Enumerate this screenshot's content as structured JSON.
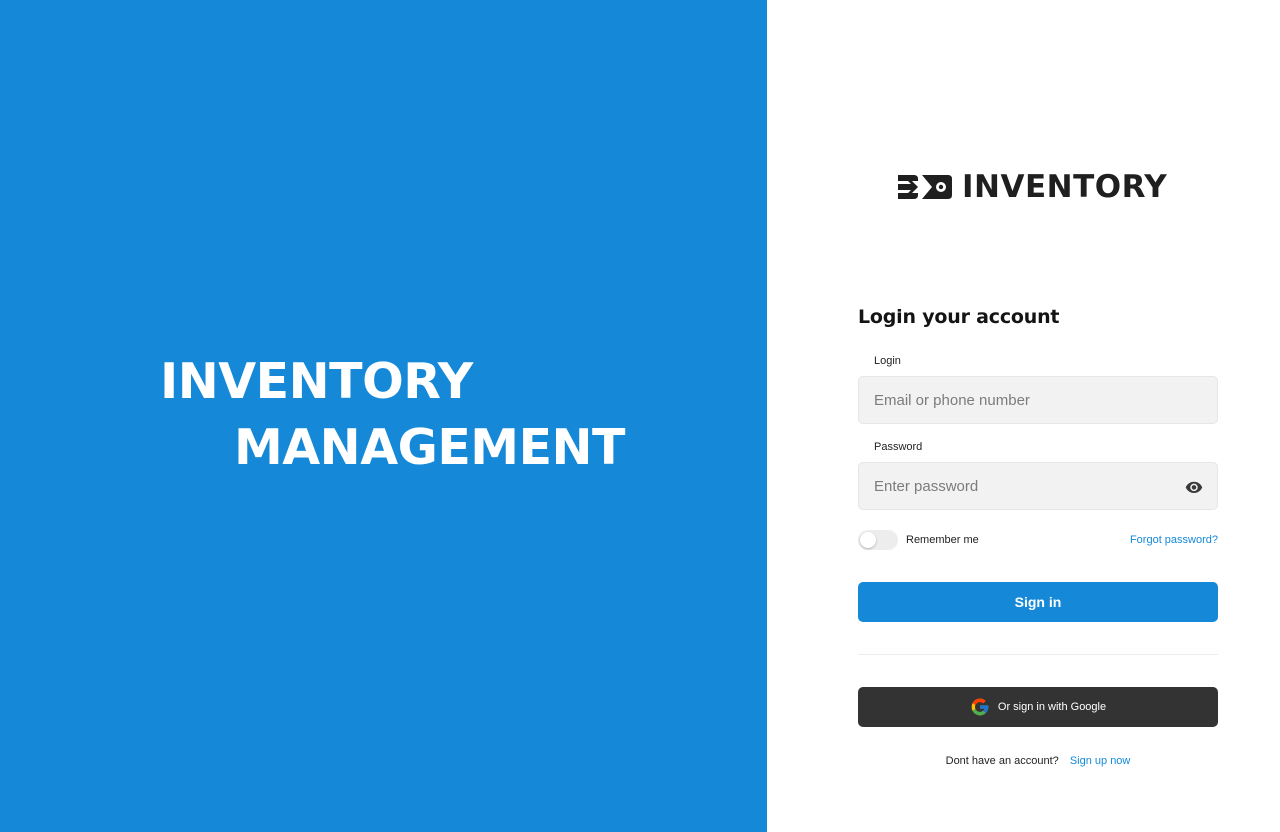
{
  "hero": {
    "line1": "INVENTORY",
    "line2": "MANAGEMENT"
  },
  "logo": {
    "icon": "inventory-logo-icon",
    "text": "INVENTORY"
  },
  "form": {
    "title": "Login your account",
    "login_label": "Login",
    "login_placeholder": "Email or phone number",
    "password_label": "Password",
    "password_placeholder": "Enter password",
    "password_toggle_icon": "eye-icon",
    "remember_label": "Remember me",
    "remember_checked": false,
    "forgot_label": "Forgot password?",
    "signin_label": "Sign in",
    "google_label": "Or sign in with Google",
    "google_icon": "google-icon",
    "signup_prompt": "Dont have an account?",
    "signup_link": "Sign up now"
  },
  "colors": {
    "brand": "#1589d8",
    "input_bg": "#f2f2f2",
    "google_button_bg": "#333333",
    "text_dark": "#141414"
  }
}
